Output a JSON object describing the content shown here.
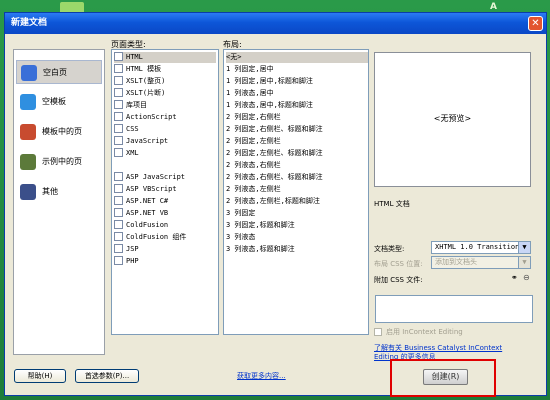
{
  "window": {
    "title": "新建文档",
    "close_glyph": "✕"
  },
  "background": {
    "accent_color": "#1f8a3a",
    "logo_text": "A"
  },
  "sidebar": {
    "items": [
      {
        "label": "空白页",
        "icon": "blank-page-icon",
        "color": "#3a6fd8",
        "selected": true
      },
      {
        "label": "空模板",
        "icon": "blank-template-icon",
        "color": "#2f8fe0",
        "selected": false
      },
      {
        "label": "模板中的页",
        "icon": "template-page-icon",
        "color": "#c84b2f",
        "selected": false
      },
      {
        "label": "示例中的页",
        "icon": "sample-page-icon",
        "color": "#5c7a3a",
        "selected": false
      },
      {
        "label": "其他",
        "icon": "other-icon",
        "color": "#3b4f8a",
        "selected": false
      }
    ]
  },
  "page_type": {
    "label": "页面类型:",
    "items": [
      {
        "label": "HTML",
        "selected": true
      },
      {
        "label": "HTML 模板",
        "selected": false
      },
      {
        "label": "XSLT(整页)",
        "selected": false
      },
      {
        "label": "XSLT(片断)",
        "selected": false
      },
      {
        "label": "库项目",
        "selected": false
      },
      {
        "label": "ActionScript",
        "selected": false
      },
      {
        "label": "CSS",
        "selected": false
      },
      {
        "label": "JavaScript",
        "selected": false
      },
      {
        "label": "XML",
        "selected": false
      },
      {
        "label": "",
        "selected": false
      },
      {
        "label": "ASP JavaScript",
        "selected": false
      },
      {
        "label": "ASP VBScript",
        "selected": false
      },
      {
        "label": "ASP.NET C#",
        "selected": false
      },
      {
        "label": "ASP.NET VB",
        "selected": false
      },
      {
        "label": "ColdFusion",
        "selected": false
      },
      {
        "label": "ColdFusion 组件",
        "selected": false
      },
      {
        "label": "JSP",
        "selected": false
      },
      {
        "label": "PHP",
        "selected": false
      }
    ]
  },
  "layout": {
    "label": "布局:",
    "items": [
      {
        "label": "<无>",
        "selected": true
      },
      {
        "label": "1 列固定,居中",
        "selected": false
      },
      {
        "label": "1 列固定,居中,标题和脚注",
        "selected": false
      },
      {
        "label": "1 列液态,居中",
        "selected": false
      },
      {
        "label": "1 列液态,居中,标题和脚注",
        "selected": false
      },
      {
        "label": "2 列固定,右侧栏",
        "selected": false
      },
      {
        "label": "2 列固定,右侧栏、标题和脚注",
        "selected": false
      },
      {
        "label": "2 列固定,左侧栏",
        "selected": false
      },
      {
        "label": "2 列固定,左侧栏、标题和脚注",
        "selected": false
      },
      {
        "label": "2 列液态,右侧栏",
        "selected": false
      },
      {
        "label": "2 列液态,右侧栏、标题和脚注",
        "selected": false
      },
      {
        "label": "2 列液态,左侧栏",
        "selected": false
      },
      {
        "label": "2 列液态,左侧栏,标题和脚注",
        "selected": false
      },
      {
        "label": "3 列固定",
        "selected": false
      },
      {
        "label": "3 列固定,标题和脚注",
        "selected": false
      },
      {
        "label": "3 列液态",
        "selected": false
      },
      {
        "label": "3 列液态,标题和脚注",
        "selected": false
      }
    ]
  },
  "preview": {
    "text": "<无预览>",
    "description": "HTML 文档"
  },
  "doctype": {
    "label": "文档类型:",
    "value": "XHTML 1.0 Transitional"
  },
  "layout_css": {
    "label": "布局 CSS 位置:",
    "value": "添加到文档头"
  },
  "attach_css": {
    "label": "附加 CSS 文件:",
    "link_icon": "link-icon",
    "remove_icon": "remove-icon"
  },
  "incontext": {
    "checkbox_label": "启用 InContext Editing",
    "checked": false,
    "link_line1": "了解有关 Business Catalyst InContext",
    "link_line2": "Editing 的更多信息"
  },
  "footer": {
    "help_label": "帮助(H)",
    "prefs_label": "首选参数(P)...",
    "more_content_label": "获取更多内容...",
    "create_label": "创建(R)"
  }
}
